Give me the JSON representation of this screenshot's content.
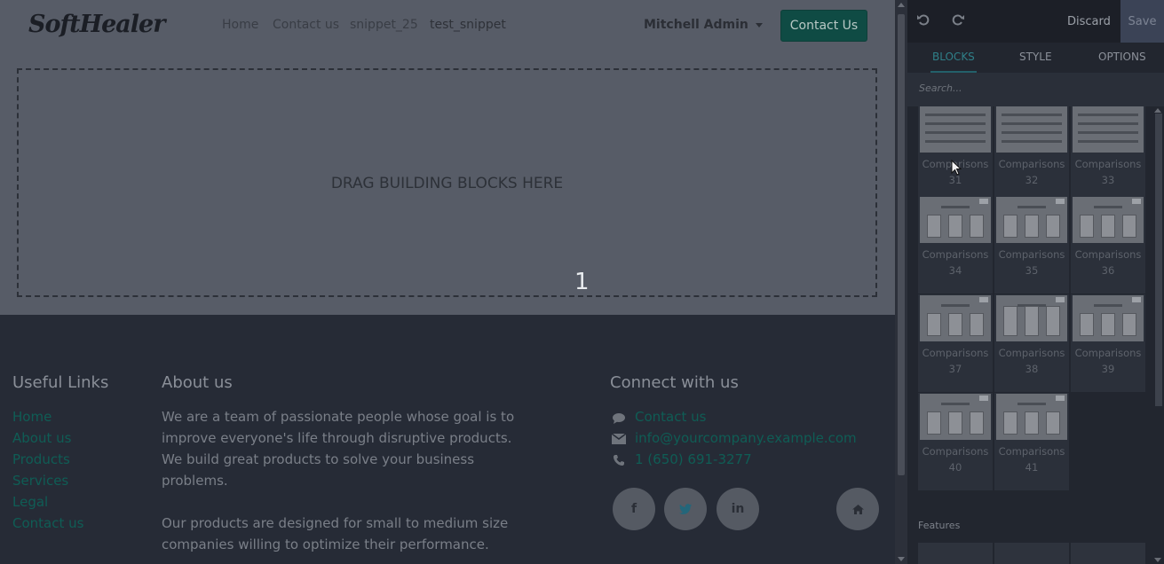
{
  "site": {
    "logo_text": "SoftHealer",
    "nav": {
      "links": [
        "Home",
        "Contact us",
        "snippet_25",
        "test_snippet"
      ],
      "user": "Mitchell Admin",
      "cta": "Contact Us"
    },
    "dropzone_text": "DRAG BUILDING BLOCKS HERE",
    "step_marker": "1",
    "footer": {
      "useful_links": {
        "title": "Useful Links",
        "items": [
          "Home",
          "About us",
          "Products",
          "Services",
          "Legal",
          "Contact us"
        ]
      },
      "about": {
        "title": "About us",
        "lines": [
          "We are a team of passionate people whose goal is to",
          "improve everyone's life through disruptive products.",
          "We build great products to solve your business",
          "problems.",
          "",
          "Our products are designed for small to medium size",
          "companies willing to optimize their performance."
        ]
      },
      "connect": {
        "title": "Connect with us",
        "contact": "Contact us",
        "email": "info@yourcompany.example.com",
        "phone": "1 (650) 691-3277"
      },
      "social_icons": [
        "facebook-icon",
        "twitter-icon",
        "linkedin-icon",
        "home-icon"
      ]
    }
  },
  "editor": {
    "discard_label": "Discard",
    "save_label": "Save",
    "tabs": [
      "BLOCKS",
      "STYLE",
      "OPTIONS"
    ],
    "active_tab": "BLOCKS",
    "search_placeholder": "Search...",
    "blocks": [
      {
        "name": "Comparisons",
        "num": "31"
      },
      {
        "name": "Comparisons",
        "num": "32"
      },
      {
        "name": "Comparisons",
        "num": "33"
      },
      {
        "name": "Comparisons",
        "num": "34"
      },
      {
        "name": "Comparisons",
        "num": "35"
      },
      {
        "name": "Comparisons",
        "num": "36"
      },
      {
        "name": "Comparisons",
        "num": "37"
      },
      {
        "name": "Comparisons",
        "num": "38"
      },
      {
        "name": "Comparisons",
        "num": "39"
      },
      {
        "name": "Comparisons",
        "num": "40"
      },
      {
        "name": "Comparisons",
        "num": "41"
      }
    ],
    "section_label": "Features"
  },
  "colors": {
    "accent": "#0f4b44",
    "link": "#0f5d55",
    "active_tab": "#2f7f88"
  }
}
